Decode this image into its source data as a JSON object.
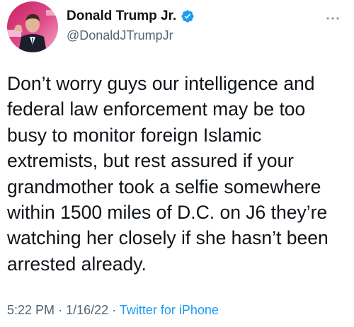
{
  "author": {
    "display_name": "Donald Trump Jr.",
    "handle": "@DonaldJTrumpJr",
    "verified": true
  },
  "tweet": {
    "text": "Don’t worry guys our intelligence and federal law enforcement may be too busy to monitor foreign Islamic extremists, but rest assured if your grandmother took a selfie somewhere within 1500 miles of D.C. on J6 they’re watching her closely if she hasn’t been arrested already.",
    "time": "5:22 PM",
    "separator": "·",
    "date": "1/16/22",
    "source": "Twitter for iPhone"
  },
  "colors": {
    "verified_badge": "#1d9bf0",
    "link": "#1d9bf0",
    "secondary_text": "#536471",
    "primary_text": "#0f1419"
  },
  "icons": {
    "more": "more-horizontal-icon",
    "verified": "verified-badge-icon"
  }
}
